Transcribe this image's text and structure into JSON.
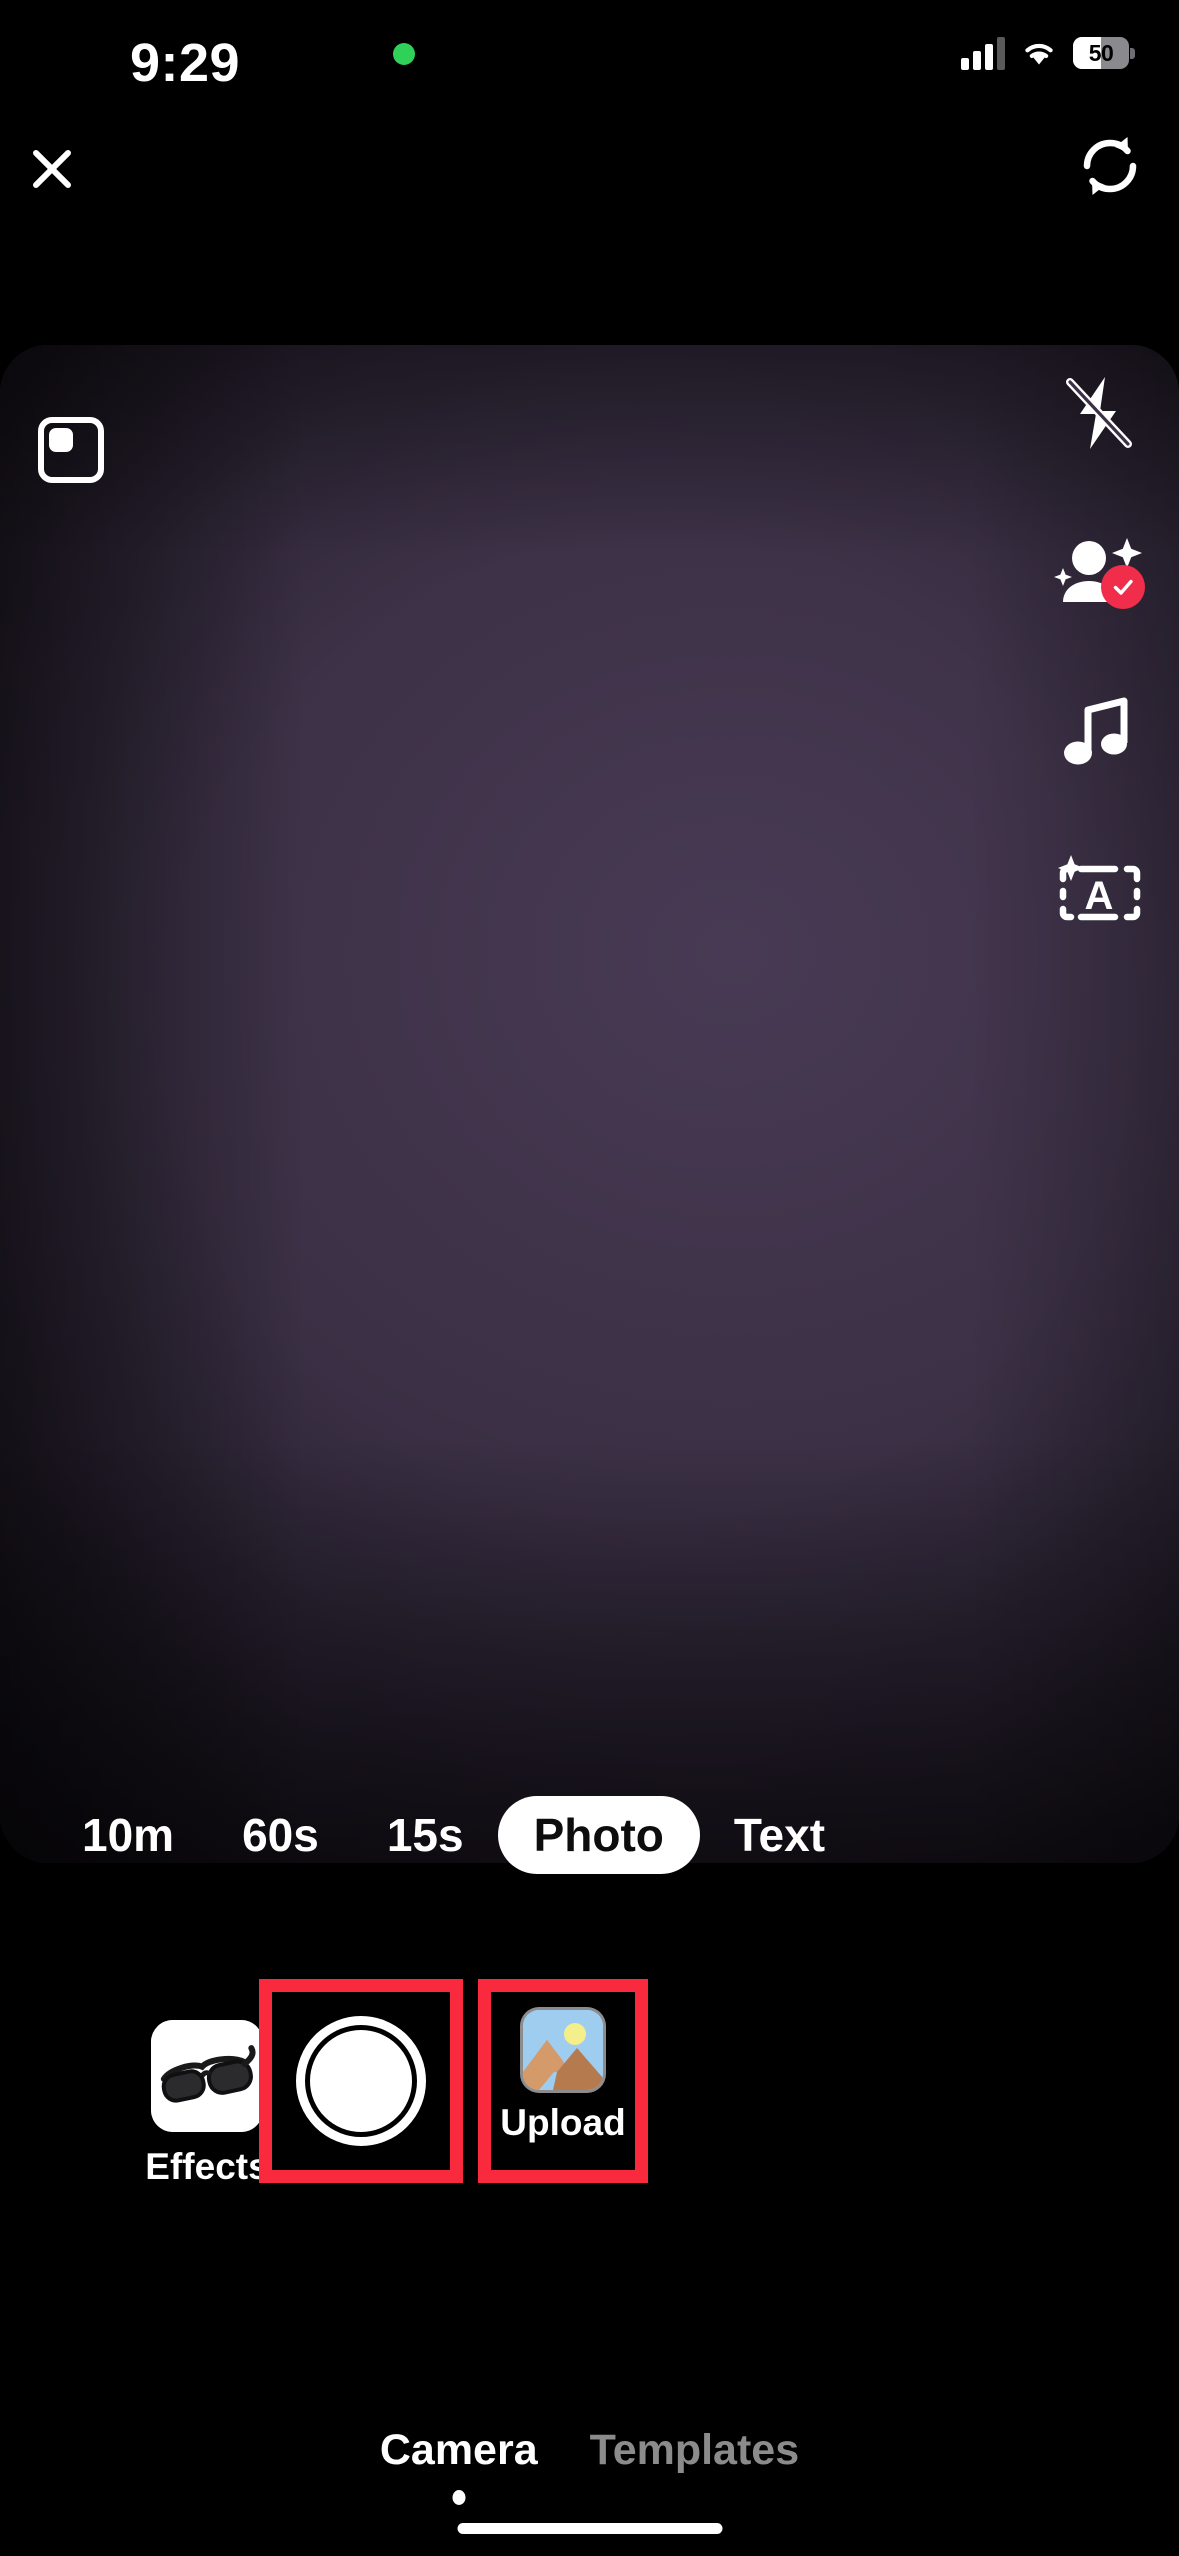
{
  "status_bar": {
    "time": "9:29",
    "recording_indicator": "green-dot",
    "cellular_icon": "cellular-signal-icon",
    "wifi_icon": "wifi-icon",
    "battery_percent": "50",
    "battery_level": 50
  },
  "top_bar": {
    "close_label": "close-icon",
    "flip_camera_label": "camera-flip-icon"
  },
  "viewfinder": {
    "aspect_ratio_icon": "aspect-ratio-icon",
    "right_rail": [
      {
        "name": "flash-off-icon",
        "label": "Flash off",
        "badge": null
      },
      {
        "name": "enhance-person-icon",
        "label": "Beauty / Enhance",
        "badge": "check"
      },
      {
        "name": "music-note-icon",
        "label": "Add sound",
        "badge": null
      },
      {
        "name": "auto-caption-icon",
        "label": "Auto captions",
        "badge": null
      }
    ]
  },
  "modes": {
    "options": [
      "10m",
      "60s",
      "15s",
      "Photo",
      "Text"
    ],
    "selected": "Photo"
  },
  "controls": {
    "effects": {
      "label": "Effects",
      "icon": "sunglasses-effect-icon"
    },
    "shutter": {
      "label": "shutter-button",
      "highlighted": true
    },
    "upload": {
      "label": "Upload",
      "icon": "photo-landscape-icon",
      "highlighted": true
    }
  },
  "bottom_tabs": {
    "items": [
      {
        "label": "Camera",
        "active": true
      },
      {
        "label": "Templates",
        "active": false
      }
    ]
  },
  "colors": {
    "annotation_red": "#FA2A3E",
    "badge_red": "#F02E4C",
    "accent_white": "#FFFFFF",
    "inactive_gray": "#8B8B8B",
    "recording_green": "#30D158"
  }
}
